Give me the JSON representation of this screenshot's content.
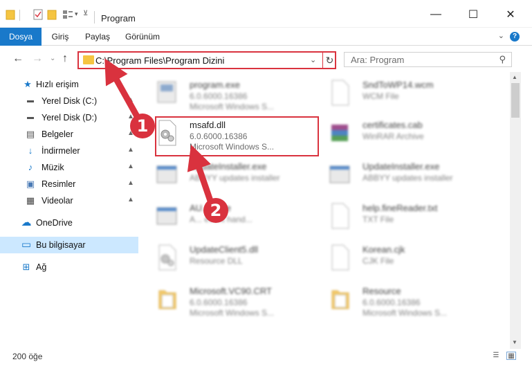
{
  "window": {
    "title": "Program",
    "minimize_glyph": "—",
    "maximize_glyph": "☐",
    "close_glyph": "✕"
  },
  "ribbon": {
    "tabs": [
      "Dosya",
      "Giriş",
      "Paylaş",
      "Görünüm"
    ],
    "help_glyph": "?",
    "expand_glyph": "⌄"
  },
  "nav": {
    "back_glyph": "←",
    "forward_glyph": "→",
    "recent_glyph": "⌄",
    "up_glyph": "↑",
    "address": "C:\\Program Files\\Program Dizini",
    "address_dropdown_glyph": "⌄",
    "refresh_glyph": "↻",
    "search_placeholder": "Ara: Program",
    "search_glyph": "⚲"
  },
  "sidebar": {
    "items": [
      {
        "label": "Hızlı erişim",
        "icon": "star-icon",
        "glyph": "★"
      },
      {
        "label": "Yerel Disk (C:)",
        "icon": "drive-icon",
        "glyph": "▬"
      },
      {
        "label": "Yerel Disk (D:)",
        "icon": "drive-icon",
        "glyph": "▬"
      },
      {
        "label": "Belgeler",
        "icon": "documents-icon",
        "glyph": "▤"
      },
      {
        "label": "İndirmeler",
        "icon": "download-icon",
        "glyph": "↓"
      },
      {
        "label": "Müzik",
        "icon": "music-icon",
        "glyph": "♪"
      },
      {
        "label": "Resimler",
        "icon": "pictures-icon",
        "glyph": "▣"
      },
      {
        "label": "Videolar",
        "icon": "videos-icon",
        "glyph": "▦"
      },
      {
        "label": "OneDrive",
        "icon": "cloud-icon",
        "glyph": "☁"
      },
      {
        "label": "Bu bilgisayar",
        "icon": "computer-icon",
        "glyph": "▭"
      },
      {
        "label": "Ağ",
        "icon": "network-icon",
        "glyph": "⊞"
      }
    ],
    "pin_glyph": "📌"
  },
  "files": [
    {
      "name": "program.exe",
      "meta1": "6.0.6000.16386",
      "meta2": "Microsoft Windows S...",
      "type": "exe"
    },
    {
      "name": "SndToWP14.wcm",
      "meta1": "WCM File",
      "meta2": "",
      "type": "doc"
    },
    {
      "name": "msafd.dll",
      "meta1": "6.0.6000.16386",
      "meta2": "Microsoft Windows S...",
      "type": "dll"
    },
    {
      "name": "certificates.cab",
      "meta1": "WinRAR Archive",
      "meta2": "",
      "type": "rar"
    },
    {
      "name": "UpdateInstaller.exe",
      "meta1": "ABBYY updates installer",
      "meta2": "",
      "type": "app"
    },
    {
      "name": "UpdateInstaller.exe",
      "meta1": "ABBYY updates installer",
      "meta2": "",
      "type": "app"
    },
    {
      "name": "AU...T.exe",
      "meta1": "A... event hand...",
      "meta2": "",
      "type": "app"
    },
    {
      "name": "help.fineReader.txt",
      "meta1": "TXT File",
      "meta2": "",
      "type": "doc"
    },
    {
      "name": "UpdateClient5.dll",
      "meta1": "Resource DLL",
      "meta2": "",
      "type": "dll"
    },
    {
      "name": "Korean.cjk",
      "meta1": "CJK File",
      "meta2": "",
      "type": "doc"
    },
    {
      "name": "Microsoft.VC90.CRT",
      "meta1": "6.0.6000.16386",
      "meta2": "Microsoft Windows S...",
      "type": "folder"
    },
    {
      "name": "Resource",
      "meta1": "6.0.6000.16386",
      "meta2": "Microsoft Windows S...",
      "type": "folder"
    }
  ],
  "status": {
    "count": "200 öğe"
  },
  "annotations": {
    "badge1": "1",
    "badge2": "2"
  }
}
